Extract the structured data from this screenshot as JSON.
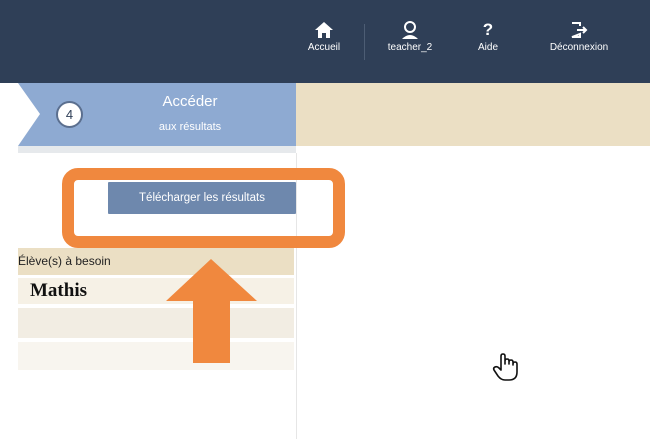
{
  "topnav": {
    "items": [
      {
        "label": "Accueil",
        "icon": "home-icon"
      },
      {
        "label": "teacher_2",
        "icon": "user-icon"
      },
      {
        "label": "Aide",
        "icon": "help-icon"
      },
      {
        "label": "Déconnexion",
        "icon": "logout-icon"
      }
    ]
  },
  "step": {
    "number": "4",
    "title": "Accéder",
    "subtitle": "aux résultats"
  },
  "download_button": "Télécharger les résultats",
  "needs": {
    "header": "Élève(s) à besoin",
    "students": [
      "Mathis"
    ]
  },
  "colors": {
    "topbar": "#2f3f57",
    "step_active": "#8eaad2",
    "step_strip": "#ebdfc4",
    "button": "#6e88ad",
    "highlight": "#f0883e"
  }
}
